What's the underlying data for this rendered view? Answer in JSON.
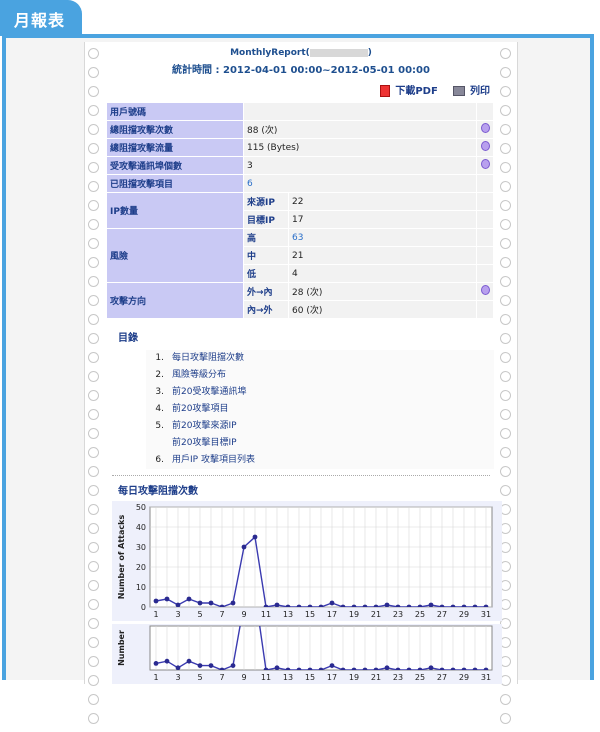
{
  "tab_label": "月報表",
  "report": {
    "title": "MonthlyReport(",
    "title_close": ")",
    "period_label": "統計時間 : 2012-04-01 00:00~2012-05-01 00:00",
    "pdf_label": "下載PDF",
    "print_label": "列印"
  },
  "summary": {
    "user_account": {
      "label": "用戶號碼",
      "value": ""
    },
    "blocked_count": {
      "label": "總阻擋攻擊次數",
      "value": "88 (次)"
    },
    "blocked_traffic": {
      "label": "總阻擋攻擊流量",
      "value": "115 (Bytes)"
    },
    "attacked_ports": {
      "label": "受攻擊通訊埠個數",
      "value": "3"
    },
    "blocked_items": {
      "label": "已阻擋攻擊項目",
      "value": "6"
    },
    "ip_count": {
      "label": "IP數量",
      "rows": [
        {
          "sub": "來源IP",
          "value": "22"
        },
        {
          "sub": "目標IP",
          "value": "17"
        }
      ]
    },
    "risk": {
      "label": "風險",
      "rows": [
        {
          "sub": "高",
          "value": "63"
        },
        {
          "sub": "中",
          "value": "21"
        },
        {
          "sub": "低",
          "value": "4"
        }
      ]
    },
    "direction": {
      "label": "攻擊方向",
      "rows": [
        {
          "sub": "外→內",
          "value": "28 (次)"
        },
        {
          "sub": "內→外",
          "value": "60 (次)"
        }
      ]
    }
  },
  "toc": {
    "title": "目錄",
    "items": [
      {
        "num": "1.",
        "text": "每日攻擊阻擋次數"
      },
      {
        "num": "2.",
        "text": "風險等級分布"
      },
      {
        "num": "3.",
        "text": "前20受攻擊通訊埠"
      },
      {
        "num": "4.",
        "text": "前20攻擊項目"
      },
      {
        "num": "5.",
        "text": "前20攻擊來源IP"
      },
      {
        "num": "",
        "text": "前20攻擊目標IP"
      },
      {
        "num": "6.",
        "text": "用戶IP 攻擊項目列表"
      }
    ]
  },
  "section_title": "每日攻擊阻擋次數",
  "colors": {
    "accent": "#4aa3e0",
    "label_bg": "#c9c9f4",
    "line": "#3a3ab0"
  },
  "chart_data": [
    {
      "type": "line",
      "ylabel": "Number of Attacks",
      "ylim": [
        0,
        50
      ],
      "yticks": [
        0,
        10,
        20,
        30,
        40,
        50
      ],
      "xticks": [
        1,
        3,
        5,
        7,
        9,
        11,
        13,
        15,
        17,
        19,
        21,
        23,
        25,
        27,
        29,
        31
      ],
      "grid": true,
      "x": [
        1,
        2,
        3,
        4,
        5,
        6,
        7,
        8,
        9,
        10,
        11,
        12,
        13,
        14,
        15,
        16,
        17,
        18,
        19,
        20,
        21,
        22,
        23,
        24,
        25,
        26,
        27,
        28,
        29,
        30,
        31
      ],
      "values": [
        3,
        4,
        1,
        4,
        2,
        2,
        0,
        2,
        30,
        35,
        0,
        1,
        0,
        0,
        0,
        0,
        2,
        0,
        0,
        0,
        0,
        1,
        0,
        0,
        0,
        1,
        0,
        0,
        0,
        0,
        0
      ]
    },
    {
      "type": "line",
      "ylabel": "Number",
      "ylim": [
        0,
        20
      ],
      "grid": true,
      "xticks": [
        1,
        3,
        5,
        7,
        9,
        11,
        13,
        15,
        17,
        19,
        21,
        23,
        25,
        27,
        29,
        31
      ],
      "x": [
        1,
        2,
        3,
        4,
        5,
        6,
        7,
        8,
        9,
        10,
        11,
        12,
        13,
        14,
        15,
        16,
        17,
        18,
        19,
        20,
        21,
        22,
        23,
        24,
        25,
        26,
        27,
        28,
        29,
        30,
        31
      ],
      "values": [
        3,
        4,
        1,
        4,
        2,
        2,
        0,
        2,
        30,
        35,
        0,
        1,
        0,
        0,
        0,
        0,
        2,
        0,
        0,
        0,
        0,
        1,
        0,
        0,
        0,
        1,
        0,
        0,
        0,
        0,
        0
      ]
    }
  ]
}
